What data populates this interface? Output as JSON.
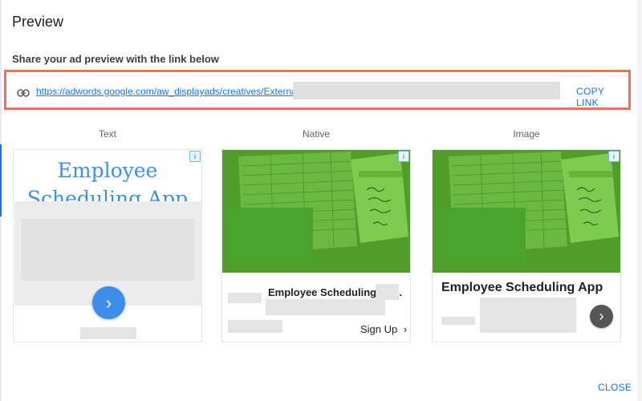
{
  "dialog": {
    "title": "Preview",
    "subtitle": "Share your ad preview with the link below",
    "link_url": "https://adwords.google.com/aw_displayads/creatives/ExternalPreview",
    "copy_link_label": "COPY LINK",
    "close_label": "CLOSE"
  },
  "columns": [
    "Text",
    "Native",
    "Image"
  ],
  "text_ad": {
    "headline": "Employee Scheduling App",
    "adchoices": "i",
    "arrow": "›"
  },
  "native_ad": {
    "headline": "Employee Scheduling App.",
    "cta": "Sign Up",
    "cta_chevron": "›",
    "adchoices": "i"
  },
  "image_ad": {
    "headline": "Employee Scheduling App",
    "arrow": "›",
    "adchoices": "i"
  },
  "colors": {
    "accent": "#1a73e8",
    "highlight_border": "#ee7352",
    "image_overlay": "#4f9e2a"
  }
}
